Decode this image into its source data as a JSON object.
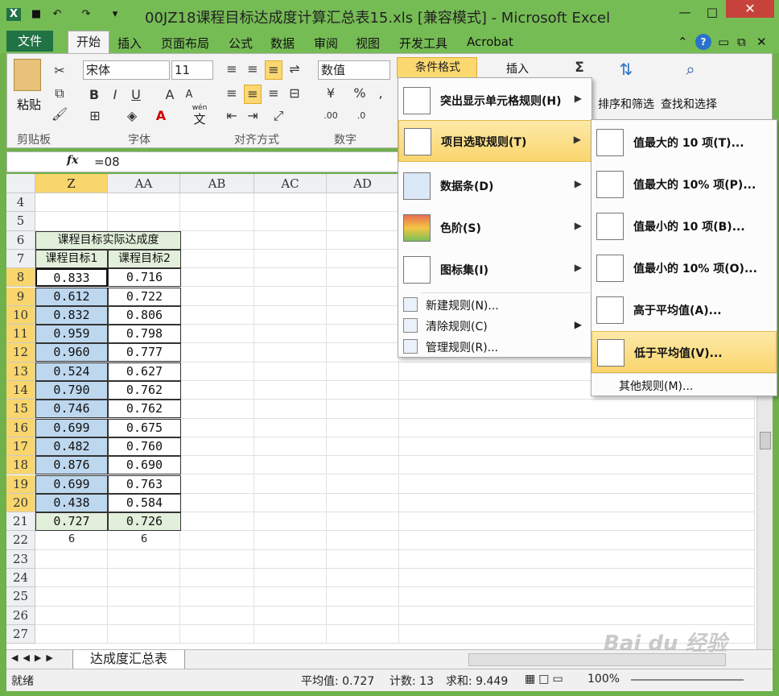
{
  "window": {
    "title": "00JZ18课程目标达成度计算汇总表15.xls  [兼容模式] - Microsoft Excel"
  },
  "ribbon_tabs": [
    "文件",
    "开始",
    "插入",
    "页面布局",
    "公式",
    "数据",
    "审阅",
    "视图",
    "开发工具",
    "Acrobat"
  ],
  "ribbon": {
    "paste": "粘贴",
    "clipboard_group": "剪贴板",
    "font_name": "宋体",
    "font_size": "11",
    "font_group": "字体",
    "align_group": "对齐方式",
    "number_format": "数值",
    "number_group": "数字",
    "cond_format": "条件格式",
    "insert": "插入",
    "sort_filter": "排序和筛选",
    "find_select": "查找和选择",
    "wen": "wén",
    "wen_char": "文"
  },
  "formula_bar": {
    "fx": "fx",
    "formula": "=08"
  },
  "columns": [
    "Z",
    "AA",
    "AB",
    "AC",
    "AD"
  ],
  "rows": [
    "4",
    "5",
    "6",
    "7",
    "8",
    "9",
    "10",
    "11",
    "12",
    "13",
    "14",
    "15",
    "16",
    "17",
    "18",
    "19",
    "20",
    "21",
    "22",
    "23",
    "24",
    "25",
    "26",
    "27"
  ],
  "table": {
    "header": "课程目标实际达成度",
    "col1": "课程目标1",
    "col2": "课程目标2",
    "values": [
      [
        "0.833",
        "0.716"
      ],
      [
        "0.612",
        "0.722"
      ],
      [
        "0.832",
        "0.806"
      ],
      [
        "0.959",
        "0.798"
      ],
      [
        "0.960",
        "0.777"
      ],
      [
        "0.524",
        "0.627"
      ],
      [
        "0.790",
        "0.762"
      ],
      [
        "0.746",
        "0.762"
      ],
      [
        "0.699",
        "0.675"
      ],
      [
        "0.482",
        "0.760"
      ],
      [
        "0.876",
        "0.690"
      ],
      [
        "0.699",
        "0.763"
      ],
      [
        "0.438",
        "0.584"
      ]
    ],
    "avg": [
      "0.727",
      "0.726"
    ],
    "count": [
      "6",
      "6"
    ]
  },
  "menu_main": {
    "items": [
      "突出显示单元格规则(H)",
      "项目选取规则(T)",
      "数据条(D)",
      "色阶(S)",
      "图标集(I)"
    ],
    "small": [
      "新建规则(N)...",
      "清除规则(C)",
      "管理规则(R)..."
    ]
  },
  "menu_sub": {
    "items": [
      "值最大的 10 项(T)...",
      "值最大的 10% 项(P)...",
      "值最小的 10 项(B)...",
      "值最小的 10% 项(O)...",
      "高于平均值(A)...",
      "低于平均值(V)..."
    ],
    "other": "其他规则(M)..."
  },
  "sheet_tab": "达成度汇总表",
  "status": {
    "ready": "就绪",
    "average": "平均值: 0.727",
    "count": "计数: 13",
    "sum": "求和: 9.449",
    "zoom": "100%"
  },
  "watermark": "Baidu经验 jingyan.baidu.com",
  "colors": {
    "accent": "#217346",
    "selected_fill": "#bdd7ee",
    "header_fill": "#e2efda",
    "menu_highlight": "#f9d56e"
  }
}
